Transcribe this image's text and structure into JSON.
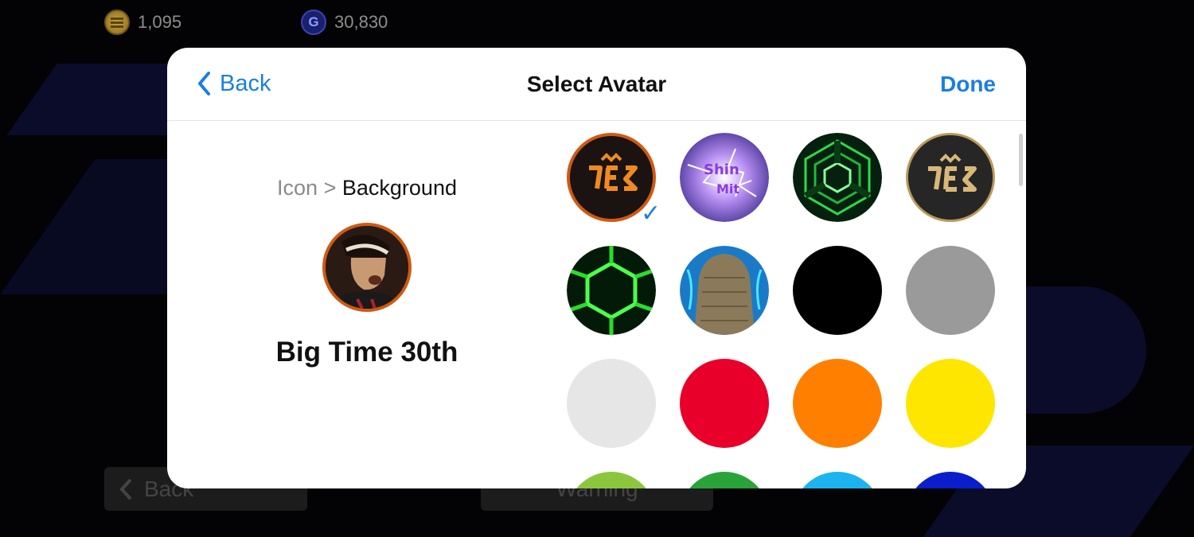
{
  "currency": {
    "coins": "1,095",
    "gp": "30,830",
    "gp_symbol": "G"
  },
  "background_buttons": {
    "back_label": "Back",
    "warning_label": "Warning"
  },
  "modal": {
    "back_label": "Back",
    "title": "Select Avatar",
    "done_label": "Done"
  },
  "left_pane": {
    "breadcrumb_parent": "Icon",
    "breadcrumb_separator": ">",
    "breadcrumb_current": "Background",
    "selected_name": "Big Time 30th"
  },
  "avatar_options": [
    {
      "name": "pes-orange-logo",
      "selected": true
    },
    {
      "name": "lightning-purple"
    },
    {
      "name": "green-hex-tunnel"
    },
    {
      "name": "pes-gold-logo"
    },
    {
      "name": "green-hex-neon"
    },
    {
      "name": "stone-cyan"
    },
    {
      "name": "black",
      "color": "#000000"
    },
    {
      "name": "gray",
      "color": "#9a9a9a"
    },
    {
      "name": "light-gray",
      "color": "#e6e6e6"
    },
    {
      "name": "red",
      "color": "#e8002a"
    },
    {
      "name": "orange",
      "color": "#ff8000"
    },
    {
      "name": "yellow",
      "color": "#ffe600"
    },
    {
      "name": "lime",
      "color": "#8cc63f"
    },
    {
      "name": "green",
      "color": "#2aa33a"
    },
    {
      "name": "sky-blue",
      "color": "#1cb4f0"
    },
    {
      "name": "blue",
      "color": "#0a1ecc"
    }
  ],
  "colors": {
    "accent": "#1a7fe0",
    "selected_ring": "#cf5a12"
  }
}
